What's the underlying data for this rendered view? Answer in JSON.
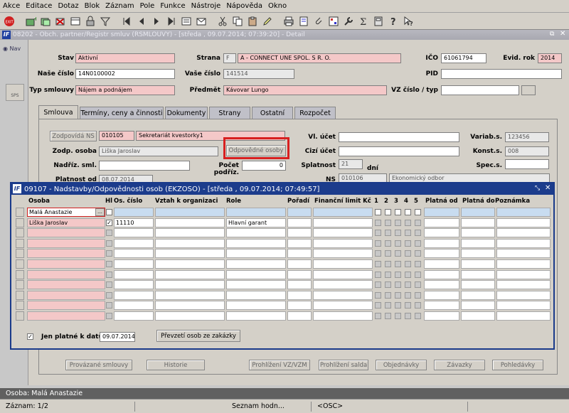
{
  "menu": [
    "Akce",
    "Editace",
    "Dotaz",
    "Blok",
    "Záznam",
    "Pole",
    "Funkce",
    "Nástroje",
    "Nápověda",
    "Okno"
  ],
  "detail": {
    "title": "08202 - Obch. partner/Registr smluv (RSMLOUVY) - [středa , 09.07.2014; 07:39:20] - Detail",
    "nav_label": "Nav",
    "side_btn": "SPS",
    "labels": {
      "stav": "Stav",
      "nase_cislo": "Naše číslo",
      "typ_smlouvy": "Typ smlouvy",
      "strana": "Strana",
      "vase_cislo": "Vaše číslo",
      "predmet": "Předmět",
      "ico": "IČO",
      "evid_rok": "Evid. rok",
      "pid": "PID",
      "vz_cislo": "VZ číslo / typ"
    },
    "values": {
      "stav": "Aktivní",
      "nase_cislo": "14N0100002",
      "typ_smlouvy": "Nájem a podnájem",
      "strana_code": "F",
      "strana_name": "A - CONNECT UNE SPOL. S R. O.",
      "vase_cislo": "141514",
      "predmet": "Kávovar Lungo",
      "ico": "61061794",
      "evid_rok": "2014"
    },
    "tabs": [
      "Smlouva",
      "Termíny, ceny a činnosti",
      "Dokumenty",
      "Strany",
      "Ostatní",
      "Rozpočet"
    ],
    "panel": {
      "zodpovida_btn": "Zodpovídá NS",
      "zodp_code": "010105",
      "zodp_name": "Sekretariát kvestorky1",
      "zodp_osoba_lbl": "Zodp. osoba",
      "zodp_osoba": "Liška Jaroslav",
      "odpovedne_btn": "Odpovědné osoby",
      "nadriz_lbl": "Nadříz. sml.",
      "pocet_lbl": "Počet podříz.",
      "pocet": "0",
      "platnost_lbl": "Platnost od",
      "platnost": "08.07.2014",
      "vl_ucet_lbl": "Vl. účet",
      "cizi_ucet_lbl": "Cizí účet",
      "splatnost_lbl": "Splatnost",
      "splatnost": "21",
      "dni": "dní",
      "ns_lbl": "NS",
      "ns_code": "010106",
      "ns_name": "Ekonomický odbor",
      "varias_lbl": "Variab.s.",
      "varias": "123456",
      "konst_lbl": "Konst.s.",
      "konst": "008",
      "spec_lbl": "Spec.s."
    },
    "bottom_buttons": [
      "Provázané smlouvy",
      "Historie",
      "Prohlížení VZ/VZM",
      "Prohlížení salda",
      "Objednávky",
      "Závazky",
      "Pohledávky"
    ]
  },
  "modal": {
    "title": "09107 - Nadstavby/Odpovědnosti osob (EKZOSO) - [středa , 09.07.2014; 07:49:57]",
    "columns": [
      "Osoba",
      "Hl",
      "Os. číslo",
      "Vztah k organizaci",
      "Role",
      "Pořadí",
      "Finanční limit Kč",
      "1",
      "2",
      "3",
      "4",
      "5",
      "Platná od",
      "Platná do",
      "Poznámka"
    ],
    "rows": [
      {
        "osoba": "Malá Anastazie",
        "hl": false,
        "os_cislo": "",
        "role": ""
      },
      {
        "osoba": "Liška Jaroslav",
        "hl": true,
        "os_cislo": "11110",
        "role": "Hlavní garant"
      }
    ],
    "jen_platne_lbl": "Jen platné k datu",
    "jen_platne_date": "09.07.2014",
    "prevzeti_btn": "Převzetí osob ze zakázky"
  },
  "status": {
    "line1": "Osoba: Malá Anastazie",
    "zaznam": "Záznam: 1/2",
    "seznam": "Seznam hodn...",
    "osc": "<OSC>"
  }
}
